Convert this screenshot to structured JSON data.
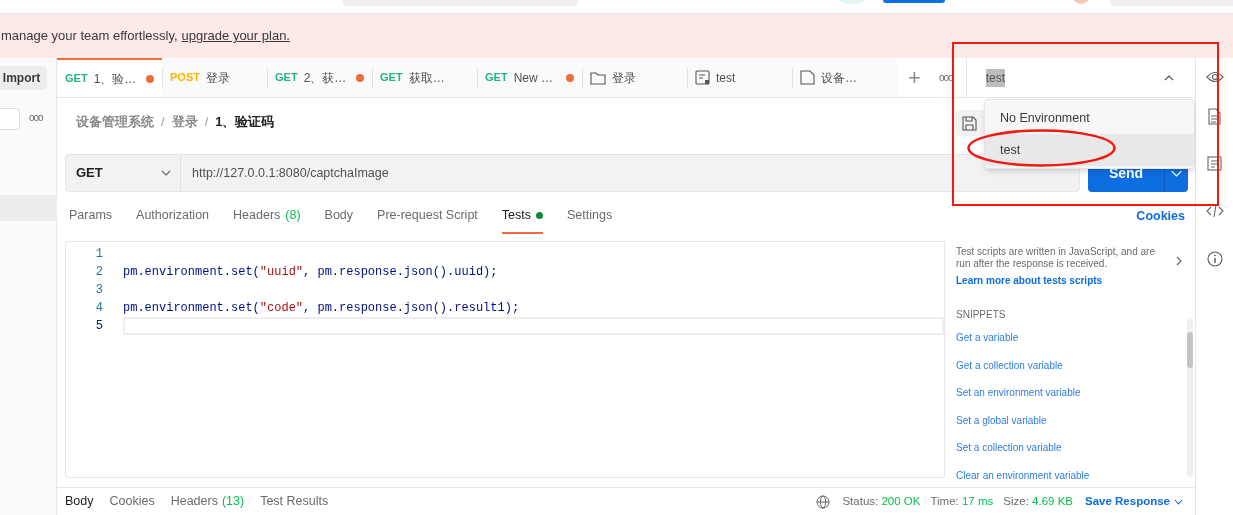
{
  "banner": {
    "text": "manage your team effortlessly,",
    "link": "upgrade your plan."
  },
  "sidebar": {
    "import_button": "Import",
    "more": "ooo"
  },
  "tabs": [
    {
      "kind": "request",
      "method": "GET",
      "color": "#26b47f",
      "title": "1、验…",
      "unsaved": true,
      "selected": true
    },
    {
      "kind": "request",
      "method": "POST",
      "color": "#ffb400",
      "title": "登录",
      "unsaved": false,
      "selected": false
    },
    {
      "kind": "request",
      "method": "GET",
      "color": "#26b47f",
      "title": "2、获…",
      "unsaved": true,
      "selected": false
    },
    {
      "kind": "request",
      "method": "GET",
      "color": "#26b47f",
      "title": "获取…",
      "unsaved": false,
      "selected": false
    },
    {
      "kind": "request",
      "method": "GET",
      "color": "#26b47f",
      "title": "New …",
      "unsaved": true,
      "selected": false
    },
    {
      "kind": "folder",
      "title": "登录",
      "unsaved": false,
      "selected": false
    },
    {
      "kind": "example",
      "title": "test",
      "unsaved": false,
      "selected": false
    },
    {
      "kind": "document",
      "title": "设备…",
      "unsaved": false,
      "selected": false
    }
  ],
  "new_tab": "+",
  "tab_more": "ooo",
  "environment": {
    "value": "test",
    "expanded": true,
    "options": [
      {
        "label": "No Environment",
        "selected": false
      },
      {
        "label": "test",
        "selected": true
      }
    ]
  },
  "breadcrumb": [
    {
      "label": "设备管理系统",
      "current": false
    },
    {
      "label": "登录",
      "current": false
    },
    {
      "label": "1、验证码",
      "current": true
    }
  ],
  "breadcrumb_separator": "/",
  "request": {
    "method": "GET",
    "url": "http://127.0.0.1:8080/captchaImage",
    "send": "Send"
  },
  "request_tabs": [
    {
      "label": "Params",
      "selected": false,
      "dot": false
    },
    {
      "label": "Authorization",
      "selected": false,
      "dot": false
    },
    {
      "label": "Headers",
      "count": "(8)",
      "selected": false,
      "dot": false
    },
    {
      "label": "Body",
      "selected": false,
      "dot": false
    },
    {
      "label": "Pre-request Script",
      "selected": false,
      "dot": false
    },
    {
      "label": "Tests",
      "selected": true,
      "dot": true
    },
    {
      "label": "Settings",
      "selected": false,
      "dot": false
    }
  ],
  "cookies_link": "Cookies",
  "code_lines": [
    {
      "number": "1",
      "current": false
    },
    {
      "number": "2",
      "code": "pm.environment.set(\"uuid\", pm.response.json().uuid);",
      "current": false
    },
    {
      "number": "3",
      "current": false
    },
    {
      "number": "4",
      "code": "pm.environment.set(\"code\", pm.response.json().result1);",
      "current": false
    },
    {
      "number": "5",
      "current": true
    }
  ],
  "snippets_panel": {
    "description": "Test scripts are written in JavaScript, and are run after the response is received.",
    "learn_more": "Learn more about tests scripts",
    "heading": "SNIPPETS",
    "items": [
      "Get a variable",
      "Get a collection variable",
      "Set an environment variable",
      "Set a global variable",
      "Set a collection variable",
      "Clear an environment variable"
    ]
  },
  "response_tabs": [
    {
      "label": "Body",
      "selected": true
    },
    {
      "label": "Cookies",
      "selected": false
    },
    {
      "label": "Headers",
      "count": "(13)",
      "selected": false
    },
    {
      "label": "Test Results",
      "selected": false
    }
  ],
  "response_stats": [
    {
      "label": "Status:",
      "value": "200 OK"
    },
    {
      "label": "Time:",
      "value": "17 ms"
    },
    {
      "label": "Size:",
      "value": "4.69 KB"
    }
  ],
  "save_response": "Save Response"
}
